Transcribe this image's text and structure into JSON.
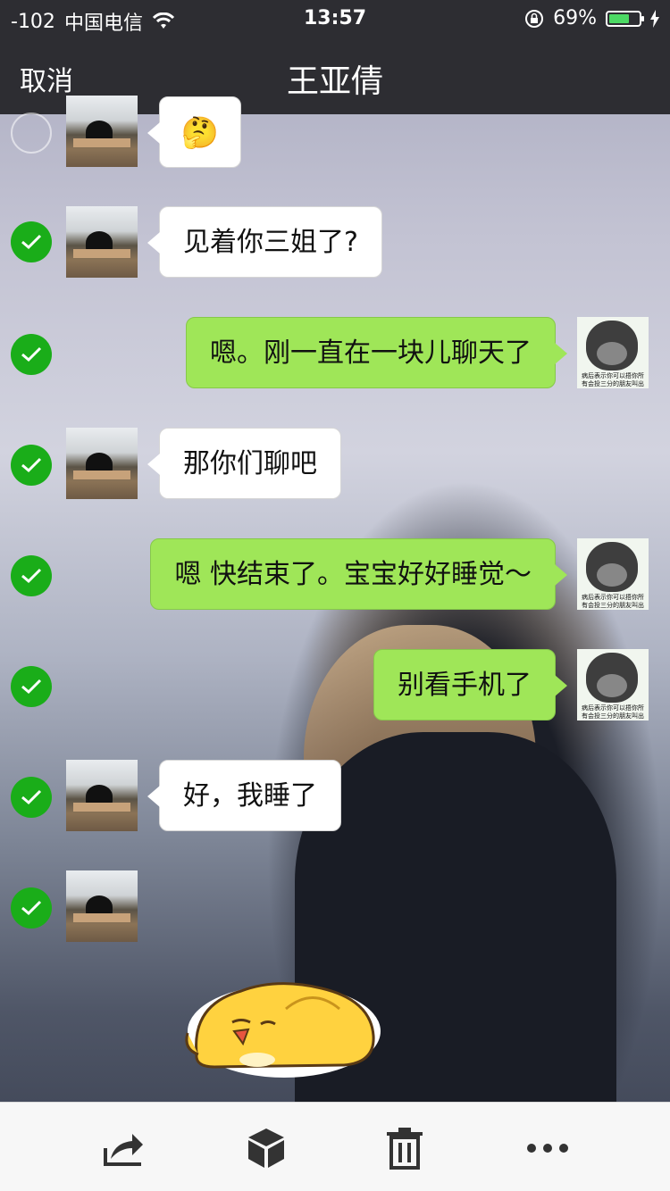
{
  "status_bar": {
    "signal": "-102",
    "carrier": "中国电信",
    "time": "13:57",
    "battery_percent": "69%",
    "battery_level": 0.69
  },
  "nav": {
    "cancel_label": "取消",
    "title": "王亚倩"
  },
  "messages": [
    {
      "side": "in",
      "selected": false,
      "text": "🤔"
    },
    {
      "side": "in",
      "selected": true,
      "text": "见着你三姐了?"
    },
    {
      "side": "out",
      "selected": true,
      "text": "嗯。刚一直在一块儿聊天了"
    },
    {
      "side": "in",
      "selected": true,
      "text": "那你们聊吧"
    },
    {
      "side": "out",
      "selected": true,
      "text": "嗯 快结束了。宝宝好好睡觉～"
    },
    {
      "side": "out",
      "selected": true,
      "text": "别看手机了"
    },
    {
      "side": "in",
      "selected": true,
      "text": "好，我睡了"
    },
    {
      "side": "in",
      "selected": true,
      "text": ""
    }
  ],
  "my_avatar_caption": [
    "病后表示你可以捂你所",
    "有会投三分的朋友叫出来"
  ],
  "toolbar": {
    "icons": [
      "share-icon",
      "favorite-box-icon",
      "delete-icon",
      "more-icon"
    ]
  },
  "colors": {
    "nav_bg": "#2d2d32",
    "outgoing_bubble": "#9fe658",
    "incoming_bubble": "#ffffff",
    "check": "#1aad19",
    "battery_fill": "#4cd964"
  }
}
